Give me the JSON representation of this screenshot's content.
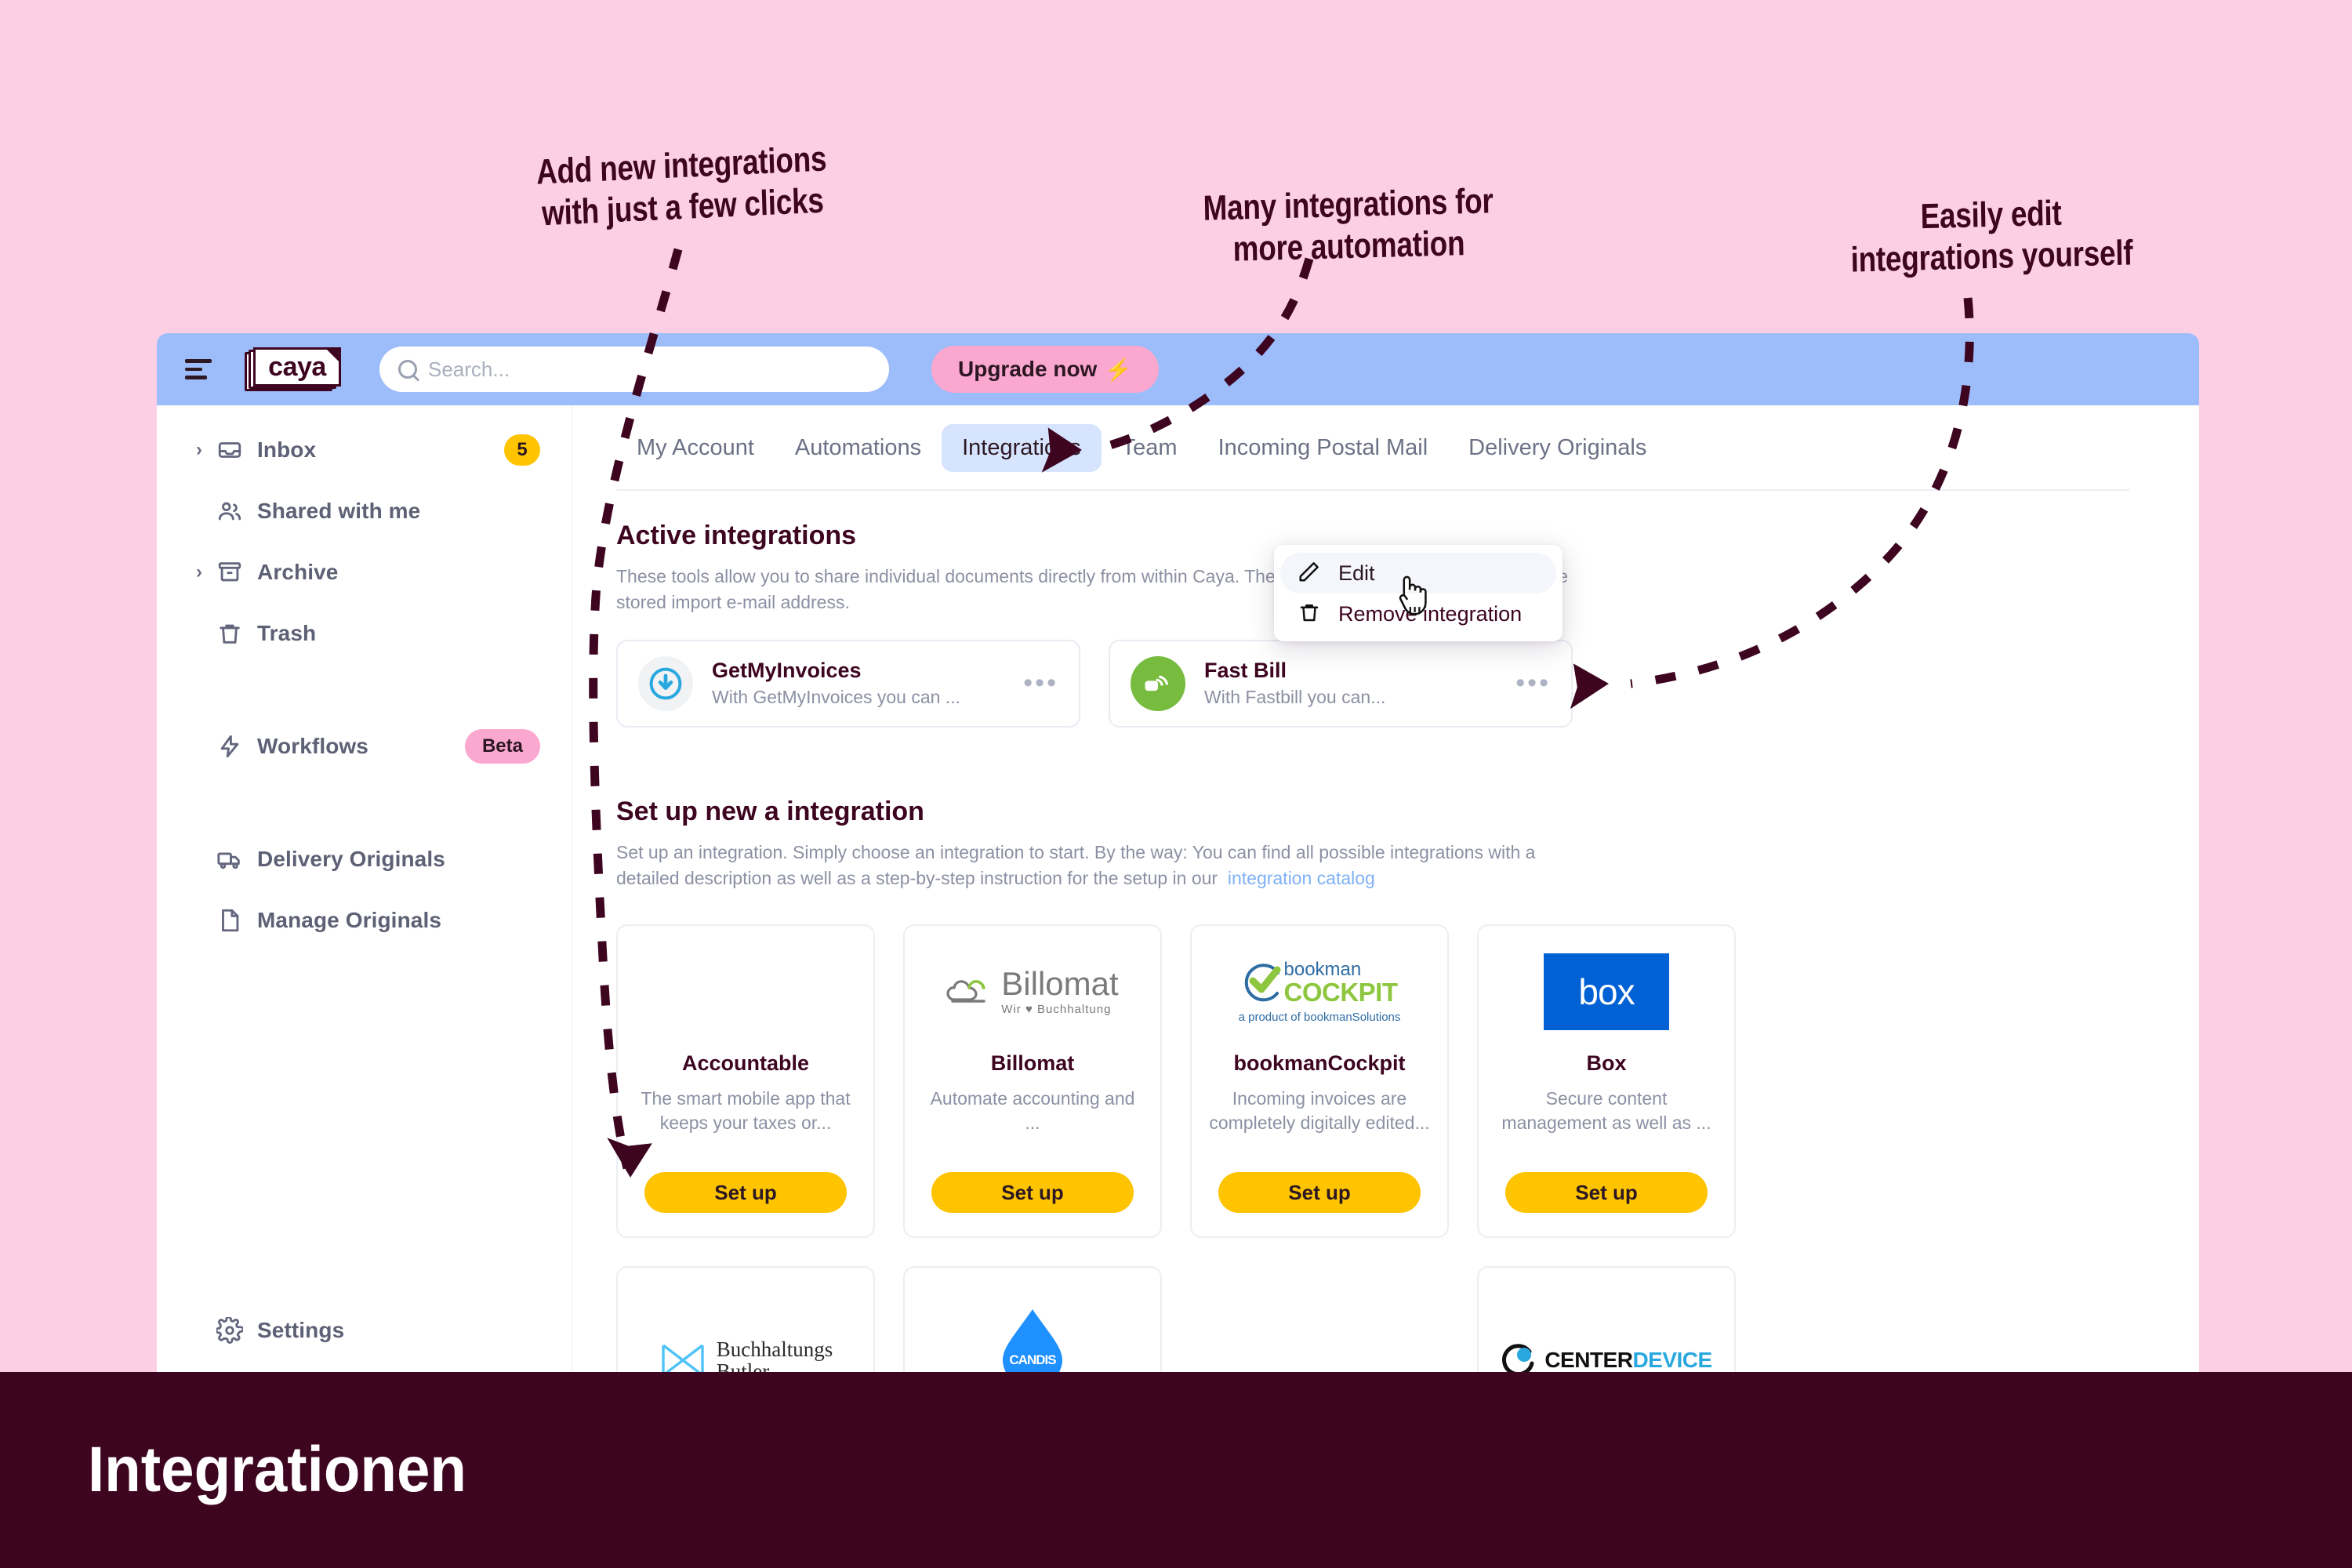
{
  "colors": {
    "page_bg": "#FCCFE4",
    "topbar_bg": "#9CBCFA",
    "accent_dark": "#3D0520",
    "accent_pink": "#FBA8D0",
    "accent_yellow": "#FFC400",
    "tab_active_bg": "#D7E4FD",
    "link_blue": "#7FB1F5"
  },
  "annotations": [
    {
      "id": "add",
      "text": "Add new integrations\nwith just a few clicks"
    },
    {
      "id": "many",
      "text": "Many integrations for\nmore automation"
    },
    {
      "id": "edit",
      "text": "Easily edit\nintegrations yourself"
    }
  ],
  "topbar": {
    "menu_icon": "hamburger-icon",
    "logo_text": "caya",
    "search": {
      "placeholder": "Search...",
      "value": "",
      "icon": "search-icon"
    },
    "upgrade_label": "Upgrade now",
    "upgrade_icon": "lightning-bolt-icon"
  },
  "sidebar": {
    "items": [
      {
        "label": "Inbox",
        "icon": "inbox-icon",
        "caret": true,
        "badge": "5",
        "badge_type": "count"
      },
      {
        "label": "Shared with me",
        "icon": "users-icon",
        "caret": false,
        "badge": null,
        "badge_type": null
      },
      {
        "label": "Archive",
        "icon": "archive-icon",
        "caret": true,
        "badge": null,
        "badge_type": null
      },
      {
        "label": "Trash",
        "icon": "trash-icon",
        "caret": false,
        "badge": null,
        "badge_type": null
      },
      {
        "label": "Workflows",
        "icon": "bolt-icon",
        "caret": false,
        "badge": "Beta",
        "badge_type": "beta"
      },
      {
        "label": "Delivery Originals",
        "icon": "truck-icon",
        "caret": false,
        "badge": null,
        "badge_type": null
      },
      {
        "label": "Manage Originals",
        "icon": "document-icon",
        "caret": false,
        "badge": null,
        "badge_type": null
      }
    ],
    "settings": {
      "label": "Settings",
      "icon": "gear-icon"
    }
  },
  "tabs": [
    {
      "label": "My Account",
      "active": false
    },
    {
      "label": "Automations",
      "active": false
    },
    {
      "label": "Integrations",
      "active": true
    },
    {
      "label": "Team",
      "active": false
    },
    {
      "label": "Incoming Postal Mail",
      "active": false
    },
    {
      "label": "Delivery Originals",
      "active": false
    }
  ],
  "active_section": {
    "title": "Active integrations",
    "description": "These tools allow you to share individual documents directly from within Caya. The sharing takes place via e-mail to the stored import e-mail address.",
    "cards": [
      {
        "name": "GetMyInvoices",
        "sub": "With GetMyInvoices you can ...",
        "icon": "getmyinvoices-icon",
        "dots": "•••"
      },
      {
        "name": "Fast Bill",
        "sub": "With Fastbill you can...",
        "icon": "fastbill-icon",
        "dots": "•••"
      }
    ]
  },
  "dropdown": {
    "items": [
      {
        "label": "Edit",
        "icon": "pencil-icon",
        "hover": true
      },
      {
        "label": "Remove integration",
        "icon": "trash-icon",
        "hover": false
      }
    ]
  },
  "setup_section": {
    "title": "Set up new a integration",
    "description_prefix": "Set up an integration. Simply choose an integration to start. By the way: You can find all possible integrations with a detailed description as well as a step-by-step instruction for the setup in our",
    "link_text": "integration catalog",
    "cards": [
      {
        "name": "Accountable",
        "desc": "The smart mobile app that keeps your taxes or...",
        "button": "Set up",
        "logo": "none"
      },
      {
        "name": "Billomat",
        "desc": "Automate accounting and ...",
        "button": "Set up",
        "logo": "billomat-logo",
        "logo_text": "Billomat",
        "logo_tagline": "Wir ♥ Buchhaltung"
      },
      {
        "name": "bookmanCockpit",
        "desc": "Incoming invoices are completely digitally edited...",
        "button": "Set up",
        "logo": "bookmancockpit-logo",
        "logo_text_top": "bookman",
        "logo_text_main": "COCKPIT",
        "logo_tagline": "a product of bookmanSolutions"
      },
      {
        "name": "Box",
        "desc": "Secure content management as well as ...",
        "button": "Set up",
        "logo": "box-logo",
        "logo_text": "box"
      }
    ],
    "cards_row2": [
      {
        "logo": "buchhaltungsbutler-logo",
        "logo_text_top": "Buchhaltungs",
        "logo_text_bottom": "Butler"
      },
      {
        "logo": "candis-logo",
        "logo_text": "CANDIS"
      },
      {
        "logo": "none",
        "logo_text": ""
      },
      {
        "logo": "centerdevice-logo",
        "logo_text_a": "CENTER",
        "logo_text_b": "DEVICE"
      }
    ]
  },
  "banner": {
    "title": "Integrationen"
  }
}
